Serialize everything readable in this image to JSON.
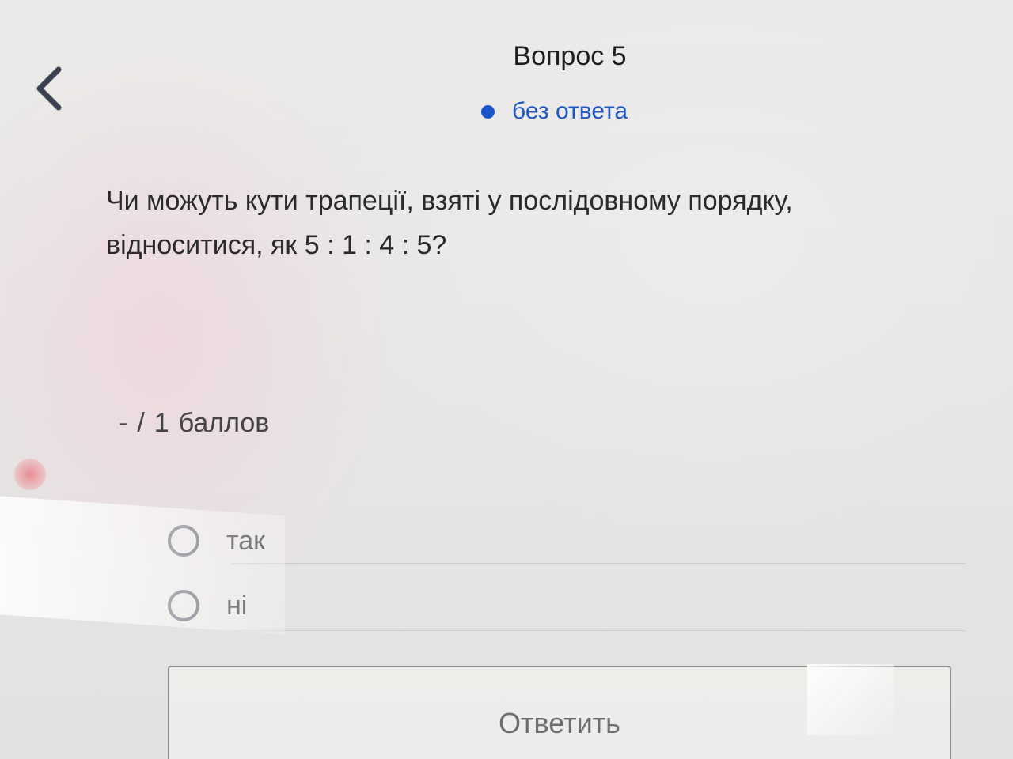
{
  "header": {
    "title": "Вопрос 5",
    "status_label": "без ответа",
    "status_color": "#1a56c9"
  },
  "question": {
    "line1": "Чи можуть кути трапеції, взяті у послідовному порядку,",
    "line2": "відноситися, як 5 : 1 : 4 : 5?"
  },
  "points": {
    "score": "-",
    "separator": "/",
    "max": "1",
    "unit": "баллов"
  },
  "options": [
    {
      "label": "так",
      "selected": false
    },
    {
      "label": "ні",
      "selected": false
    }
  ],
  "submit": {
    "label": "Ответить"
  },
  "icons": {
    "back": "chevron-left-icon"
  }
}
